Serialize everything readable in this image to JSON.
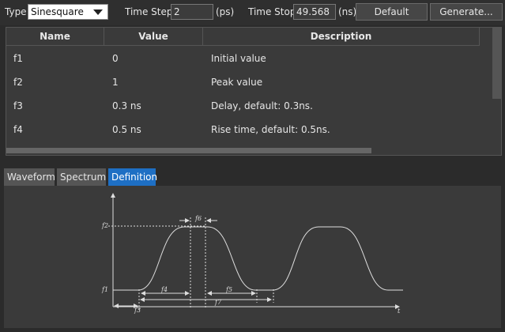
{
  "toolbar": {
    "type_label": "Type:",
    "type_value": "Sinesquare",
    "timestep_label": "Time Step:",
    "timestep_value": "2",
    "timestep_unit": "(ps)",
    "timestop_label": "Time Stop:",
    "timestop_value": "49.568",
    "timestop_unit": "(ns)",
    "default_label": "Default",
    "generate_label": "Generate..."
  },
  "table": {
    "headers": [
      "Name",
      "Value",
      "Description"
    ],
    "rows": [
      {
        "name": "f1",
        "value": "0",
        "description": "Initial value"
      },
      {
        "name": "f2",
        "value": "1",
        "description": "Peak value"
      },
      {
        "name": "f3",
        "value": "0.3 ns",
        "description": "Delay, default: 0.3ns."
      },
      {
        "name": "f4",
        "value": "0.5 ns",
        "description": "Rise time, default: 0.5ns."
      }
    ]
  },
  "tabs": [
    {
      "label": "Waveform",
      "active": false
    },
    {
      "label": "Spectrum",
      "active": false
    },
    {
      "label": "Definition",
      "active": true
    }
  ],
  "diagram": {
    "labels": {
      "f1": "f1",
      "f2": "f2",
      "f3": "f3",
      "f4": "f4",
      "f5": "f5",
      "f6": "f6",
      "f7": "f7",
      "t": "t"
    }
  },
  "colors": {
    "accent": "#1e6fc4",
    "background": "#2b2b2b",
    "panel": "#3a3a3a"
  }
}
